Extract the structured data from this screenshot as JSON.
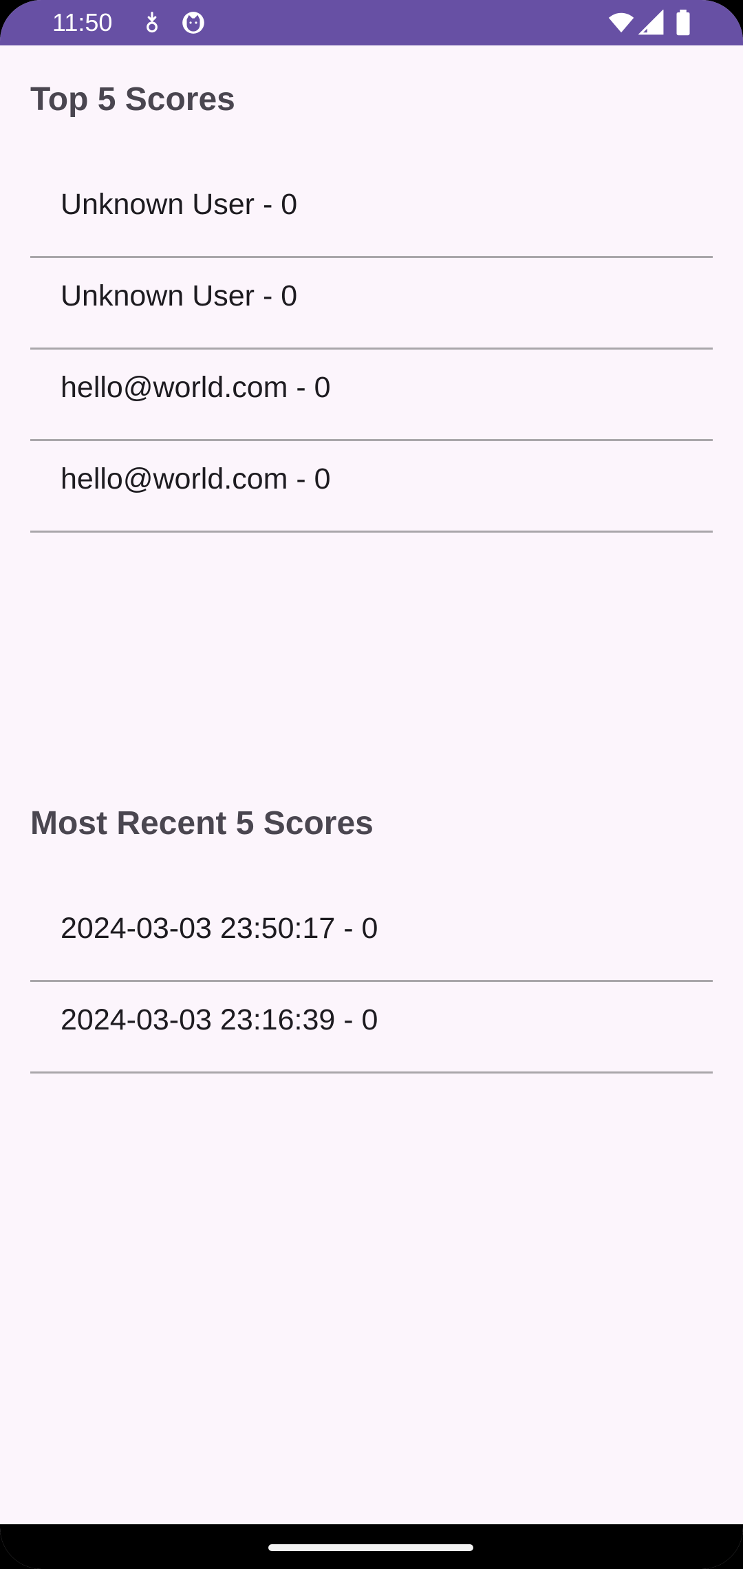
{
  "status_bar": {
    "time": "11:50",
    "left_icons": [
      "download-notification-icon",
      "cat-app-notification-icon"
    ],
    "right_icons": [
      "wifi-icon",
      "cell-signal-icon",
      "battery-icon"
    ],
    "background_color": "#6750a4"
  },
  "top_scores": {
    "title": "Top 5 Scores",
    "items": [
      {
        "label": "Unknown User - 0"
      },
      {
        "label": "Unknown User - 0"
      },
      {
        "label": "hello@world.com - 0"
      },
      {
        "label": "hello@world.com - 0"
      }
    ]
  },
  "recent_scores": {
    "title": "Most Recent 5 Scores",
    "items": [
      {
        "label": "2024-03-03 23:50:17 - 0"
      },
      {
        "label": "2024-03-03 23:16:39 - 0"
      }
    ]
  },
  "colors": {
    "background": "#fcf5fc",
    "title_text": "#4a4650",
    "item_text": "#1d1b20",
    "divider": "#a9a6aa"
  }
}
